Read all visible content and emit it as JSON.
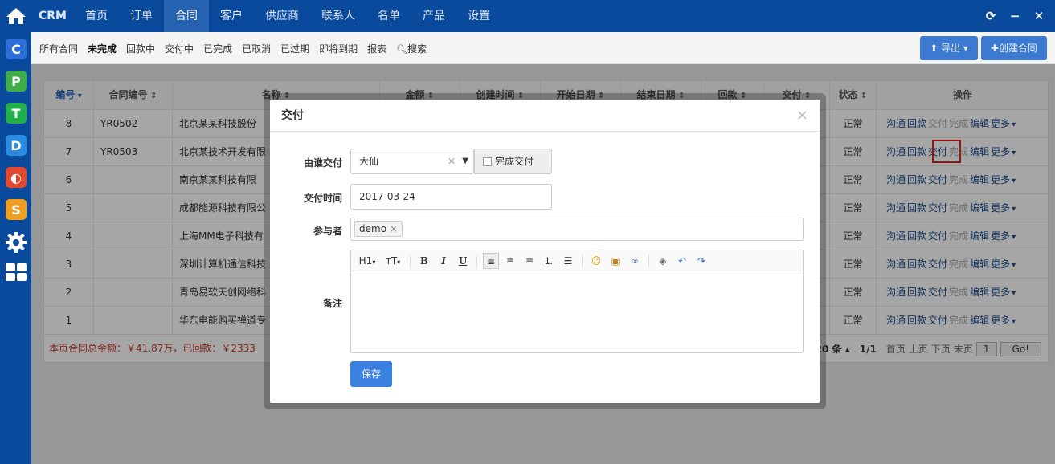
{
  "topbar": {
    "brand": "CRM",
    "nav": [
      "首页",
      "订单",
      "合同",
      "客户",
      "供应商",
      "联系人",
      "名单",
      "产品",
      "设置"
    ],
    "active_index": 2,
    "controls": [
      "refresh-icon",
      "minimize-icon",
      "close-icon"
    ]
  },
  "sidebar": {
    "apps": [
      {
        "letter": "C",
        "color": "#2d6fd6"
      },
      {
        "letter": "P",
        "color": "#3fae49"
      },
      {
        "letter": "T",
        "color": "#23b04a"
      },
      {
        "letter": "D",
        "color": "#2b8be0"
      },
      {
        "letter": "◐",
        "color": "#e24a2f"
      },
      {
        "letter": "S",
        "color": "#f0a020"
      }
    ]
  },
  "subnav": {
    "tabs": [
      "所有合同",
      "未完成",
      "回款中",
      "交付中",
      "已完成",
      "已取消",
      "已过期",
      "即将到期",
      "报表",
      "搜索"
    ],
    "bold_index": 1,
    "export_label": "导出",
    "create_label": "创建合同"
  },
  "table": {
    "headers": [
      "编号",
      "合同编号",
      "名称",
      "金额",
      "创建时间",
      "开始日期",
      "结束日期",
      "回款",
      "交付",
      "状态",
      "操作"
    ],
    "rows": [
      {
        "id": "8",
        "code": "YR0502",
        "name": "北京某某科技股份",
        "status": "正常"
      },
      {
        "id": "7",
        "code": "YR0503",
        "name": "北京某技术开发有限",
        "status": "正常"
      },
      {
        "id": "6",
        "code": "",
        "name": "南京某某科技有限",
        "status": "正常"
      },
      {
        "id": "5",
        "code": "",
        "name": "成都能源科技有限公",
        "status": "正常"
      },
      {
        "id": "4",
        "code": "",
        "name": "上海MM电子科技有",
        "status": "正常"
      },
      {
        "id": "3",
        "code": "",
        "name": "深圳计算机通信科技",
        "status": "正常"
      },
      {
        "id": "2",
        "code": "",
        "name": "青岛易软天创网络科",
        "status": "正常"
      },
      {
        "id": "1",
        "code": "",
        "name": "华东电能购买禅道专",
        "status": "正常"
      }
    ],
    "ops": {
      "comm": "沟通",
      "payment": "回款",
      "deliver": "交付",
      "done": "完成",
      "edit": "编辑",
      "more": "更多"
    },
    "footer_summary": "本页合同总金额：￥41.87万，已回款：￥2333",
    "pager": {
      "per_page": "20 条",
      "pages": "1/1",
      "first": "首页",
      "prev": "上页",
      "next": "下页",
      "last": "末页",
      "page_input": "1",
      "go": "Go!"
    }
  },
  "modal": {
    "title": "交付",
    "who_label": "由谁交付",
    "who_value": "大仙",
    "complete_label": "完成交付",
    "time_label": "交付时间",
    "time_value": "2017-03-24",
    "participants_label": "参与者",
    "participant_tag": "demo",
    "notes_label": "备注",
    "save_label": "保存",
    "toolbar": {
      "heading": "H1",
      "size": "тT",
      "bold": "B",
      "italic": "I",
      "underline": "U"
    }
  }
}
